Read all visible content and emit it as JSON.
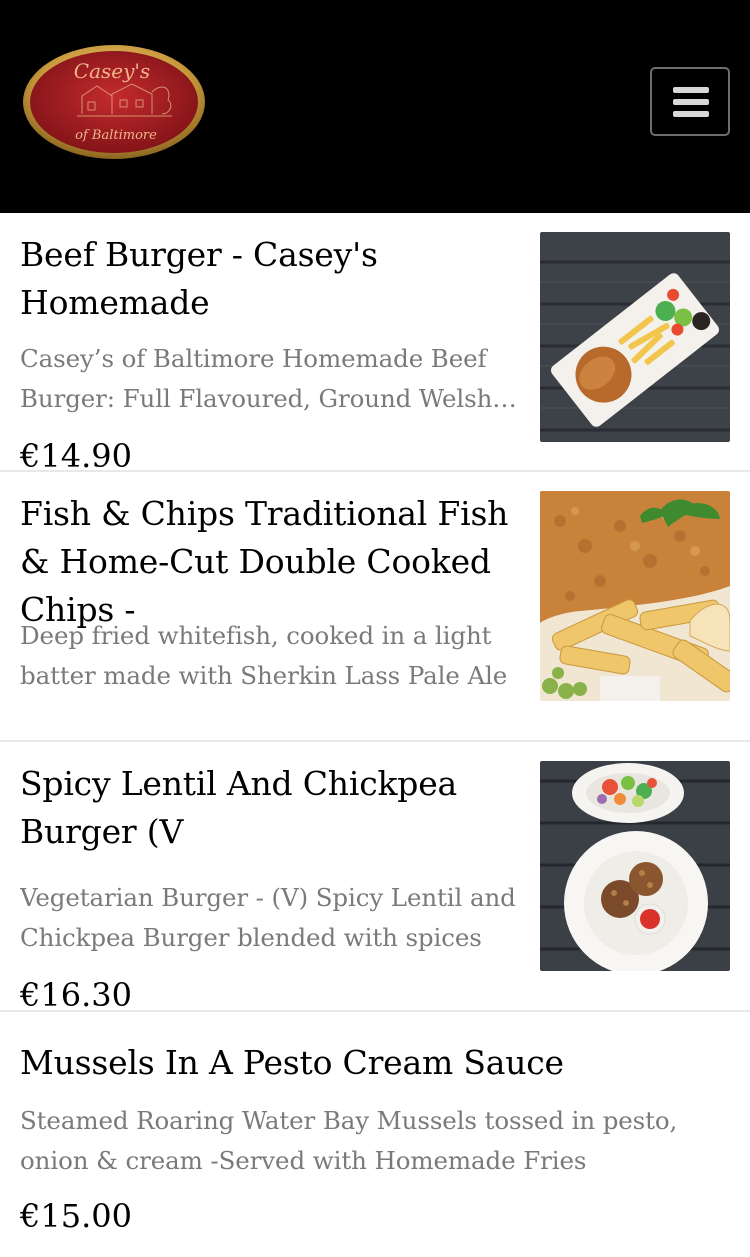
{
  "header": {
    "logo": {
      "name_text": "Casey's",
      "sub_text": "of Baltimore"
    },
    "menu_icon": "hamburger-menu-icon"
  },
  "colors": {
    "header_bg": "#000000",
    "logo_red": "#a61c22",
    "logo_gold": "#d9b25a",
    "description_gray": "#7a7a7a",
    "divider": "#e8e8e8"
  },
  "menu_items": [
    {
      "title": "Beef Burger - Casey's Homemade",
      "description": "Casey’s of Baltimore Homemade Beef Burger: Full Flavoured, Ground Welsh Beef",
      "price": "€14.90",
      "image": "beef-burger-photo"
    },
    {
      "title": "Fish & Chips Traditional Fish & Home-Cut Double Cooked Chips -",
      "description": "Deep fried whitefish, cooked in a light batter made with Sherkin Lass Pale Ale",
      "price": "",
      "image": "fish-and-chips-photo"
    },
    {
      "title": "Spicy Lentil And Chickpea Burger (V",
      "description": "Vegetarian Burger - (V) Spicy Lentil and Chickpea Burger blended with spices",
      "price": "€16.30",
      "image": "lentil-burger-photo"
    },
    {
      "title": "Mussels In A Pesto Cream Sauce",
      "description": "Steamed Roaring Water Bay Mussels tossed in pesto, onion & cream -Served with Homemade Fries",
      "price": "€15.00",
      "image": ""
    }
  ]
}
